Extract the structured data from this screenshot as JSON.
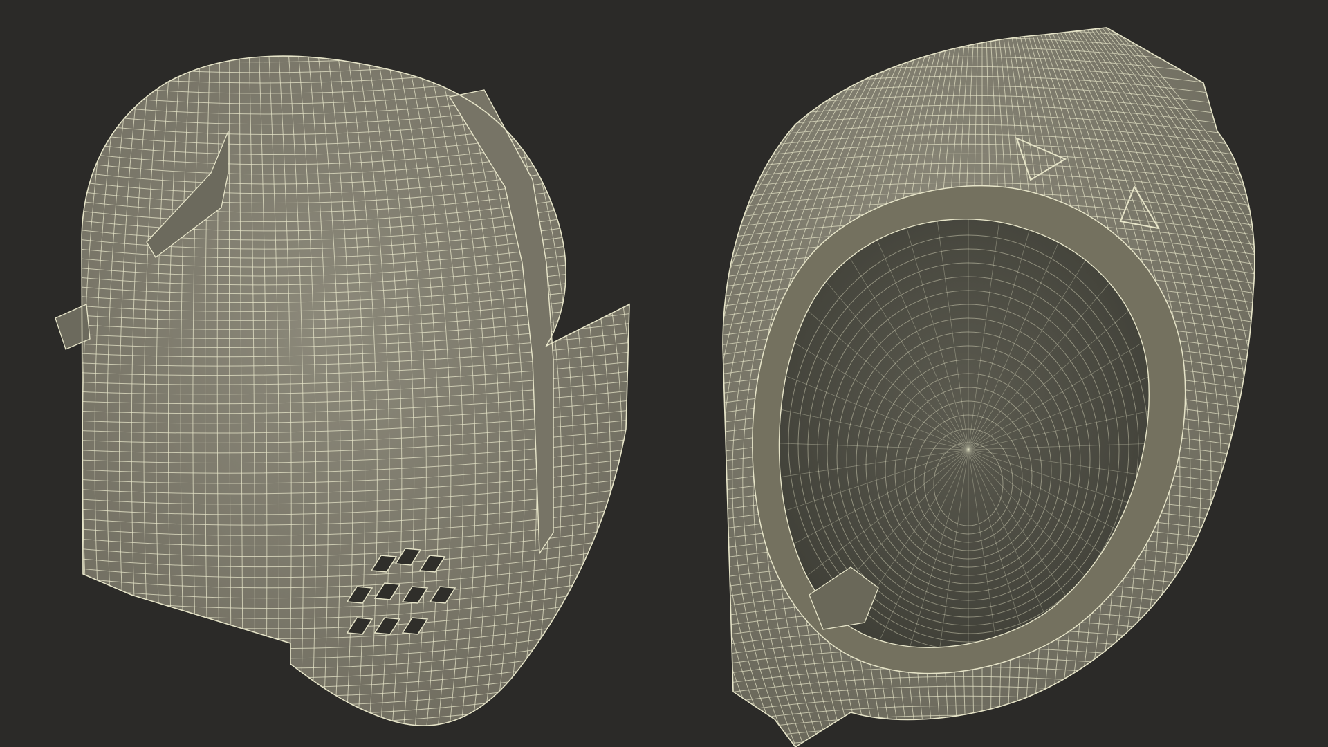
{
  "scene": {
    "background_color": "#2b2a28",
    "mesh_fill": "#807d6f",
    "mesh_shade": "#5f5d52",
    "wire_color": "#e6e4c8",
    "interior_color": "#4a4a40",
    "objects": [
      {
        "name": "helmet-exterior-view"
      },
      {
        "name": "helmet-interior-view"
      }
    ]
  }
}
